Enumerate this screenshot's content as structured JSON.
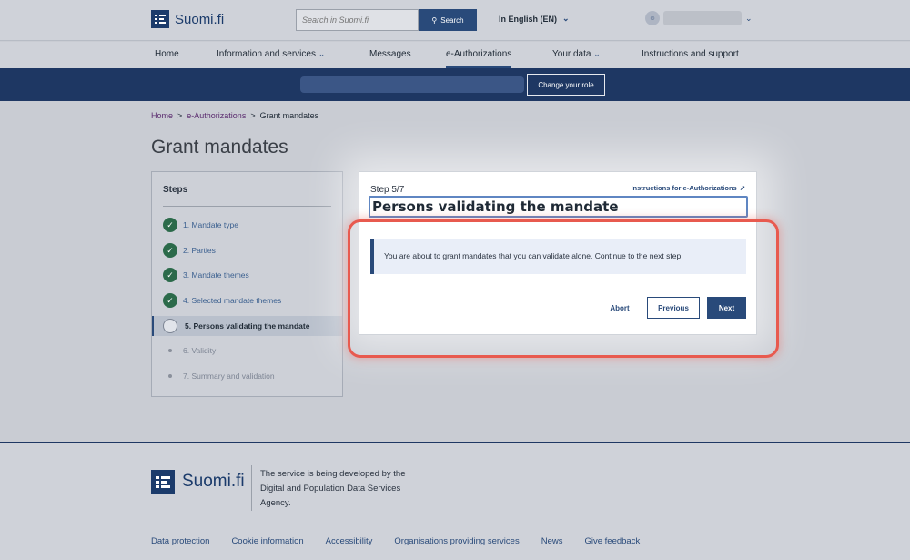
{
  "header": {
    "logo_text": "Suomi.fi",
    "search_placeholder": "Search in Suomi.fi",
    "search_button": "Search",
    "language": "In English (EN)",
    "avatar_initials": "≗"
  },
  "nav": {
    "items": [
      "Home",
      "Information and services",
      "Messages",
      "e-Authorizations",
      "Your data",
      "Instructions and support"
    ]
  },
  "rolebar": {
    "change_role": "Change your role"
  },
  "breadcrumb": {
    "home": "Home",
    "sep1": ">",
    "eauth": "e-Authorizations",
    "sep2": ">",
    "current": "Grant mandates"
  },
  "page_title": "Grant mandates",
  "steps": {
    "title": "Steps",
    "items": [
      "1. Mandate type",
      "2. Parties",
      "3. Mandate themes",
      "4. Selected mandate themes",
      "5. Persons validating the mandate",
      "6. Validity",
      "7. Summary and validation"
    ]
  },
  "card": {
    "step": "Step 5/7",
    "instructions_link": "Instructions for e-Authorizations",
    "heading": "Persons validating the mandate",
    "info": "You are about to grant mandates that you can validate alone. Continue to the next step.",
    "abort": "Abort",
    "previous": "Previous",
    "next": "Next"
  },
  "footer": {
    "logo_text": "Suomi.fi",
    "description": "The service is being developed by the Digital and Population Data Services Agency.",
    "links": [
      "Data protection",
      "Cookie information",
      "Accessibility",
      "Organisations providing services",
      "News",
      "Give feedback"
    ]
  },
  "colors": {
    "brand": "#1e3763",
    "accent": "#294a7a",
    "highlight": "#e85a4f",
    "done": "#2b6a4a"
  }
}
